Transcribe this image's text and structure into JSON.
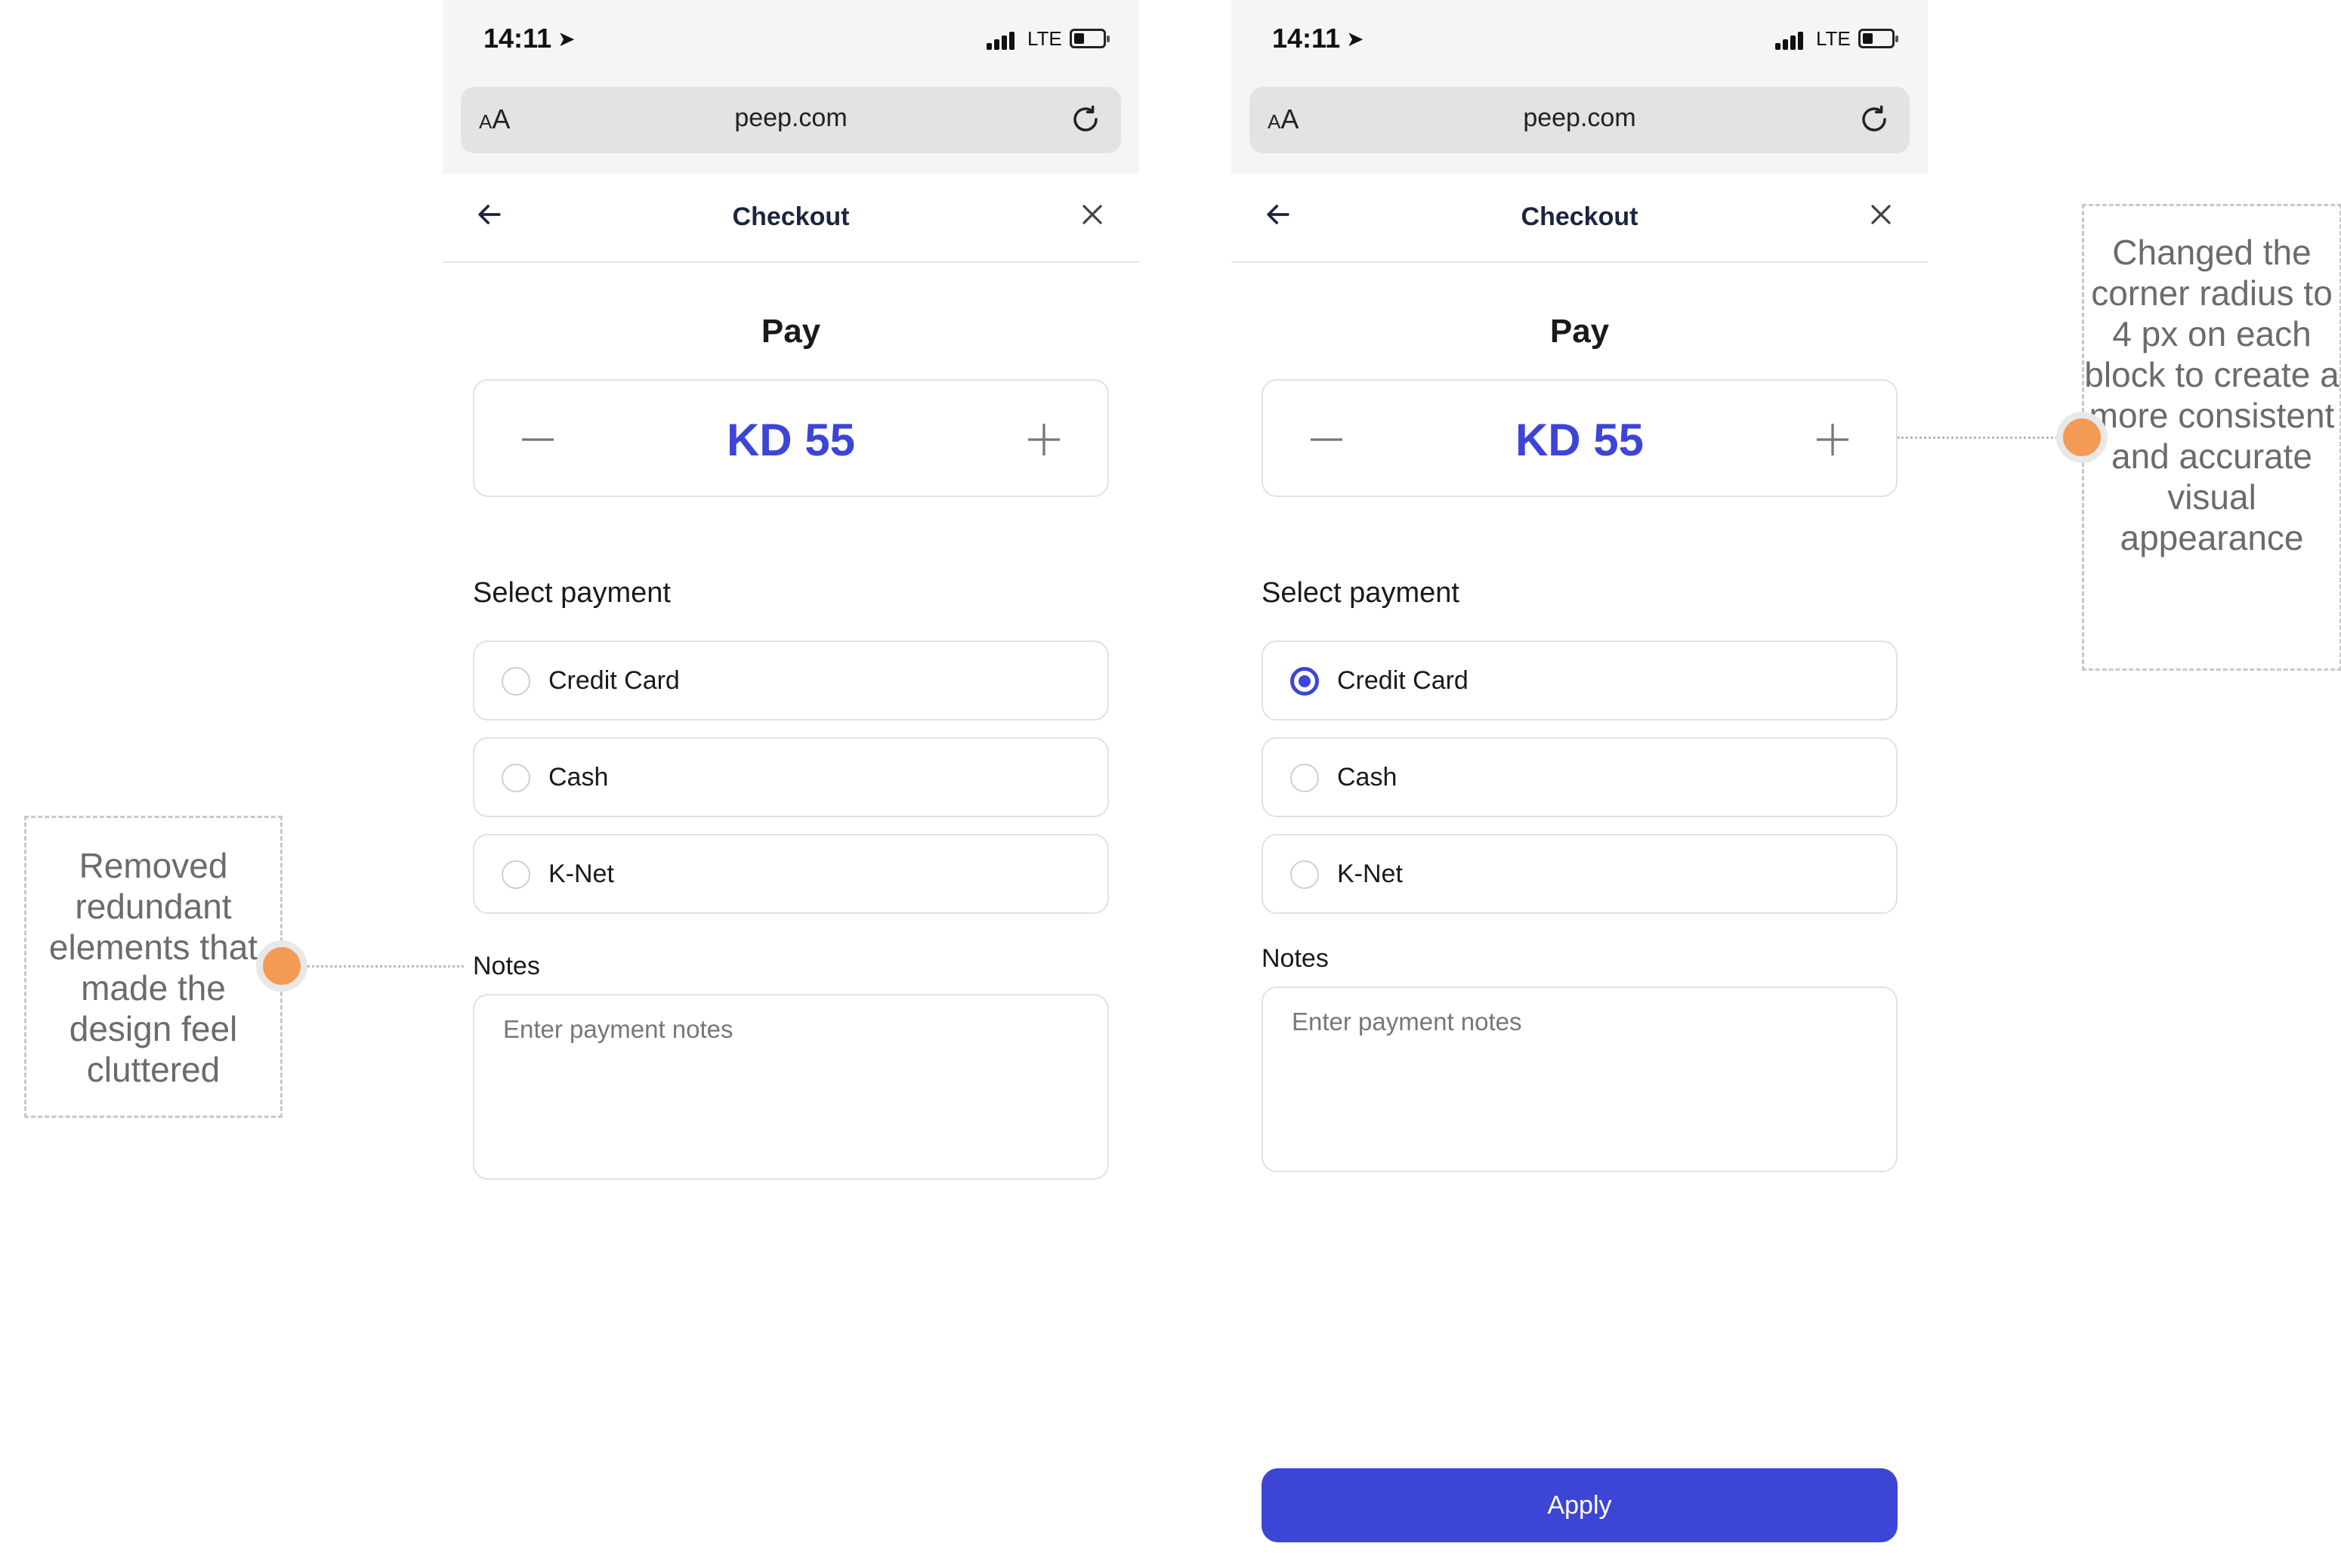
{
  "colors": {
    "accent": "#3d45d6",
    "callout_dot": "#f39a55",
    "title": "#1c2540"
  },
  "screens": [
    {
      "status": {
        "time": "14:11",
        "network": "LTE"
      },
      "browser": {
        "text_size_label": "AA",
        "url": "peep.com"
      },
      "header": {
        "title": "Checkout",
        "icons": [
          "back-arrow-icon",
          "close-icon"
        ]
      },
      "pay_title": "Pay",
      "amount": "KD 55",
      "payment": {
        "label": "Select payment",
        "options": [
          {
            "label": "Credit Card",
            "selected": false
          },
          {
            "label": "Cash",
            "selected": false
          },
          {
            "label": "K-Net",
            "selected": false
          }
        ]
      },
      "notes": {
        "label": "Notes",
        "placeholder": "Enter payment notes",
        "value": ""
      }
    },
    {
      "status": {
        "time": "14:11",
        "network": "LTE"
      },
      "browser": {
        "text_size_label": "AA",
        "url": "peep.com"
      },
      "header": {
        "title": "Checkout",
        "icons": [
          "back-arrow-icon",
          "close-icon"
        ]
      },
      "pay_title": "Pay",
      "amount": "KD 55",
      "payment": {
        "label": "Select payment",
        "options": [
          {
            "label": "Credit Card",
            "selected": true
          },
          {
            "label": "Cash",
            "selected": false
          },
          {
            "label": "K-Net",
            "selected": false
          }
        ]
      },
      "notes": {
        "label": "Notes",
        "placeholder": "Enter payment notes",
        "value": ""
      },
      "apply_label": "Apply"
    }
  ],
  "annotations": {
    "left": "Removed redundant elements that made the design feel cluttered",
    "right": "Changed the corner radius to 4 px on each block to create a more consistent and accurate visual appearance"
  }
}
